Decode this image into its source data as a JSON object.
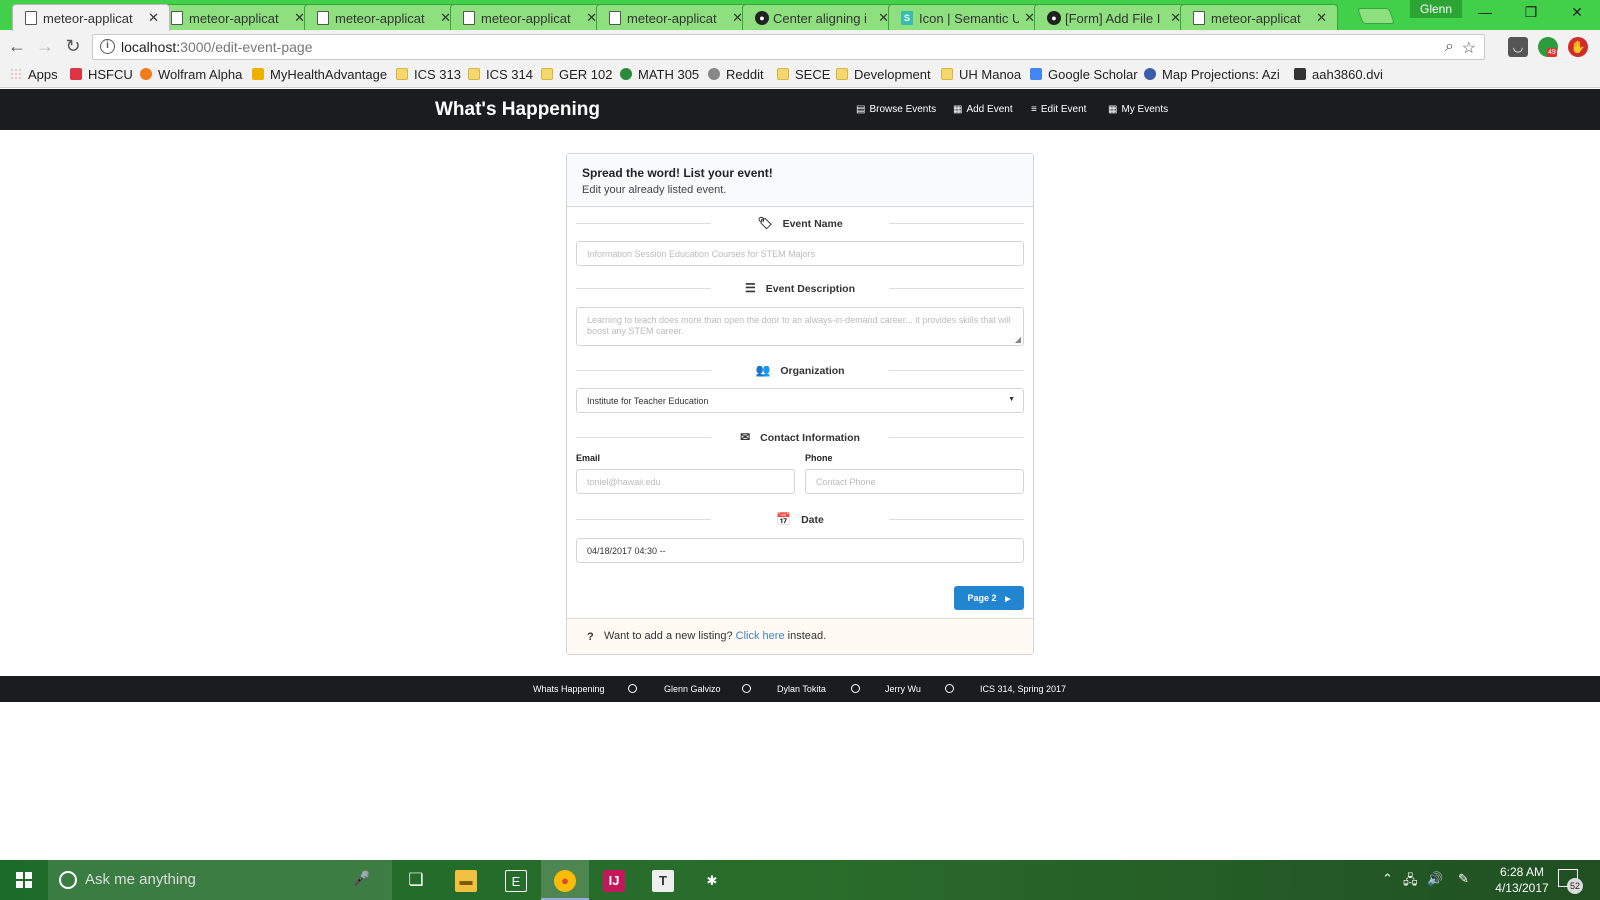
{
  "browser": {
    "tabs": [
      {
        "title": "meteor-applicat",
        "icon": "page-icon",
        "active": true
      },
      {
        "title": "meteor-applicat",
        "icon": "page-icon",
        "active": false
      },
      {
        "title": "meteor-applicat",
        "icon": "page-icon",
        "active": false
      },
      {
        "title": "meteor-applicat",
        "icon": "page-icon",
        "active": false
      },
      {
        "title": "meteor-applicat",
        "icon": "page-icon",
        "active": false
      },
      {
        "title": "Center aligning i",
        "icon": "github-icon",
        "active": false
      },
      {
        "title": "Icon | Semantic U",
        "icon": "semantic-icon",
        "active": false
      },
      {
        "title": "[Form] Add File I",
        "icon": "github-icon",
        "active": false
      },
      {
        "title": "meteor-applicat",
        "icon": "page-icon",
        "active": false
      }
    ],
    "tab_close": "✕",
    "profile_name": "Glenn",
    "url_host": "localhost:",
    "url_path": "3000/edit-event-page",
    "extension_badge": "49",
    "bookmarks": [
      {
        "label": "Apps",
        "icon": "apps-icon"
      },
      {
        "label": "HSFCU",
        "icon": "hsfcu-icon"
      },
      {
        "label": "Wolfram Alpha",
        "icon": "wolfram-icon"
      },
      {
        "label": "MyHealthAdvantage",
        "icon": "health-icon"
      },
      {
        "label": "ICS 313",
        "icon": "folder-icon"
      },
      {
        "label": "ICS 314",
        "icon": "folder-icon"
      },
      {
        "label": "GER 102",
        "icon": "folder-icon"
      },
      {
        "label": "MATH 305",
        "icon": "math-icon"
      },
      {
        "label": "Reddit",
        "icon": "reddit-icon"
      },
      {
        "label": "SECE",
        "icon": "folder-icon"
      },
      {
        "label": "Development",
        "icon": "folder-icon"
      },
      {
        "label": "UH Manoa",
        "icon": "folder-icon"
      },
      {
        "label": "Google Scholar",
        "icon": "scholar-icon"
      },
      {
        "label": "Map Projections: Azim",
        "icon": "globe-icon"
      },
      {
        "label": "aah3860.dvi",
        "icon": "image-icon"
      }
    ]
  },
  "app": {
    "brand": "What's Happening",
    "nav": [
      {
        "label": "Browse Events",
        "icon": "list-icon"
      },
      {
        "label": "Add Event",
        "icon": "calendar-icon"
      },
      {
        "label": "Edit Event",
        "icon": "edit-icon"
      },
      {
        "label": "My Events",
        "icon": "calendar-icon"
      }
    ],
    "form": {
      "title": "Spread the word! List your event!",
      "subtitle": "Edit your already listed event.",
      "event_name_label": "Event Name",
      "event_name_placeholder": "Information Session Education Courses for STEM Majors",
      "event_description_label": "Event Description",
      "event_description_placeholder": "Learning to teach does more than open the door to an always-in-demand career... it provides skills that will boost any STEM career.",
      "organization_label": "Organization",
      "organization_value": "Institute for Teacher Education",
      "contact_label": "Contact Information",
      "email_label": "Email",
      "email_placeholder": "toniel@hawaii.edu",
      "phone_label": "Phone",
      "phone_placeholder": "Contact Phone",
      "date_label": "Date",
      "date_value": "04/18/2017 04:30 --",
      "next_button": "Page 2",
      "footer_q": "?",
      "footer_before": "Want to add a new listing? ",
      "footer_link": "Click here",
      "footer_after": " instead."
    },
    "footer": [
      "Whats Happening",
      "Glenn Galvizo",
      "Dylan Tokita",
      "Jerry Wu",
      "ICS 314, Spring 2017"
    ]
  },
  "taskbar": {
    "search_placeholder": "Ask me anything",
    "time": "6:28 AM",
    "date": "4/13/2017",
    "notification_count": "52"
  },
  "colors": {
    "chrome_frame": "#42d04a",
    "app_nav": "#1b1c1d",
    "primary_button": "#2185d0",
    "link": "#4183c4"
  }
}
